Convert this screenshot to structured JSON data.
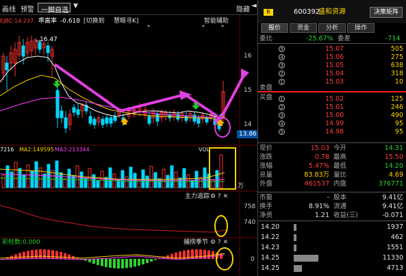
{
  "toolbar": {
    "huaxian": "画线",
    "yujing": "预警",
    "period": "一脚自选",
    "hide": "隐藏"
  },
  "indicator_bar": {
    "name": "乖离率",
    "value": "-0.618",
    "switch": "[切换到",
    "smart": "慧眼寻K]",
    "assist": "智能辅助",
    "left_fragment": "EJBC:14.237"
  },
  "price_axis": {
    "top": "16",
    "mid": "15",
    "low": "14",
    "current": "13.86"
  },
  "peak_label": "16.47",
  "vol_bar": {
    "left": "7216",
    "ma2": "MA2:149595",
    "ma3": "MA3:213344",
    "vol": "VOL",
    "unit": "万"
  },
  "sub1": {
    "title": "主力追踪",
    "v1": "758",
    "v2": "740"
  },
  "sub2": {
    "left_label": "彩柱数:0.000",
    "title": "捕捞季节",
    "zero": "0"
  },
  "panel": {
    "code": "600392",
    "name": "盛和资源",
    "btn": "决策矩阵",
    "r_badge": "R",
    "tabs": [
      "报价",
      "资金",
      "分析",
      "操作"
    ],
    "weibi_label": "委比",
    "weibi": "-25.67%",
    "weicha_label": "委差",
    "weicha": "-714",
    "sell_label": "卖盘",
    "buy_label": "买盘",
    "asks": [
      {
        "lvl": "5",
        "p": "15.07",
        "v": "505"
      },
      {
        "lvl": "4",
        "p": "15.06",
        "v": "275"
      },
      {
        "lvl": "3",
        "p": "15.05",
        "v": "638"
      },
      {
        "lvl": "2",
        "p": "15.04",
        "v": "318"
      },
      {
        "lvl": "1",
        "p": "15.03",
        "v": "10"
      }
    ],
    "bids": [
      {
        "lvl": "1",
        "p": "15.02",
        "v": "125"
      },
      {
        "lvl": "2",
        "p": "15.01",
        "v": "246"
      },
      {
        "lvl": "3",
        "p": "15.00",
        "v": "490"
      },
      {
        "lvl": "4",
        "p": "14.99",
        "v": "95"
      },
      {
        "lvl": "5",
        "p": "14.98",
        "v": "95"
      }
    ],
    "quote": [
      {
        "l1": "现价",
        "v1": "15.03",
        "c1": "red",
        "l2": "今开",
        "v2": "14.31",
        "c2": "grn"
      },
      {
        "l1": "涨跌",
        "v1": "0.78",
        "c1": "red",
        "l2": "最高",
        "v2": "15.50",
        "c2": "red"
      },
      {
        "l1": "涨幅",
        "v1": "5.47%",
        "c1": "red",
        "l2": "最低",
        "v2": "14.20",
        "c2": "grn"
      },
      {
        "l1": "总量",
        "v1": "83.83万",
        "c1": "yel",
        "l2": "量比",
        "v2": "4.69",
        "c2": "yel"
      },
      {
        "l1": "外盘",
        "v1": "461537",
        "c1": "red",
        "l2": "内盘",
        "v2": "376771",
        "c2": "grn"
      }
    ],
    "quote2": [
      {
        "l1": "市盈",
        "v1": "-",
        "l2": "股本",
        "v2": "9.41亿"
      },
      {
        "l1": "换手",
        "v1": "8.91%",
        "l2": "流通",
        "v2": "9.41亿"
      },
      {
        "l1": "净资",
        "v1": "1.21",
        "l2": "收益(三)",
        "v2": "-0.071"
      }
    ],
    "ticks": [
      {
        "t": "14.20",
        "v": "1937"
      },
      {
        "t": "14.22",
        "v": "462"
      },
      {
        "t": "14.23",
        "v": "1551"
      },
      {
        "t": "14.25",
        "v": "11330"
      },
      {
        "t": "14.25",
        "v": "4713"
      }
    ]
  },
  "colors": {
    "up": "#ff3030",
    "down": "#00e0ff",
    "ma5": "#ffffff",
    "ma10": "#ffd400",
    "ma20": "#ff40ff",
    "arrow": "#e040e0",
    "circle": "#e040e0"
  }
}
